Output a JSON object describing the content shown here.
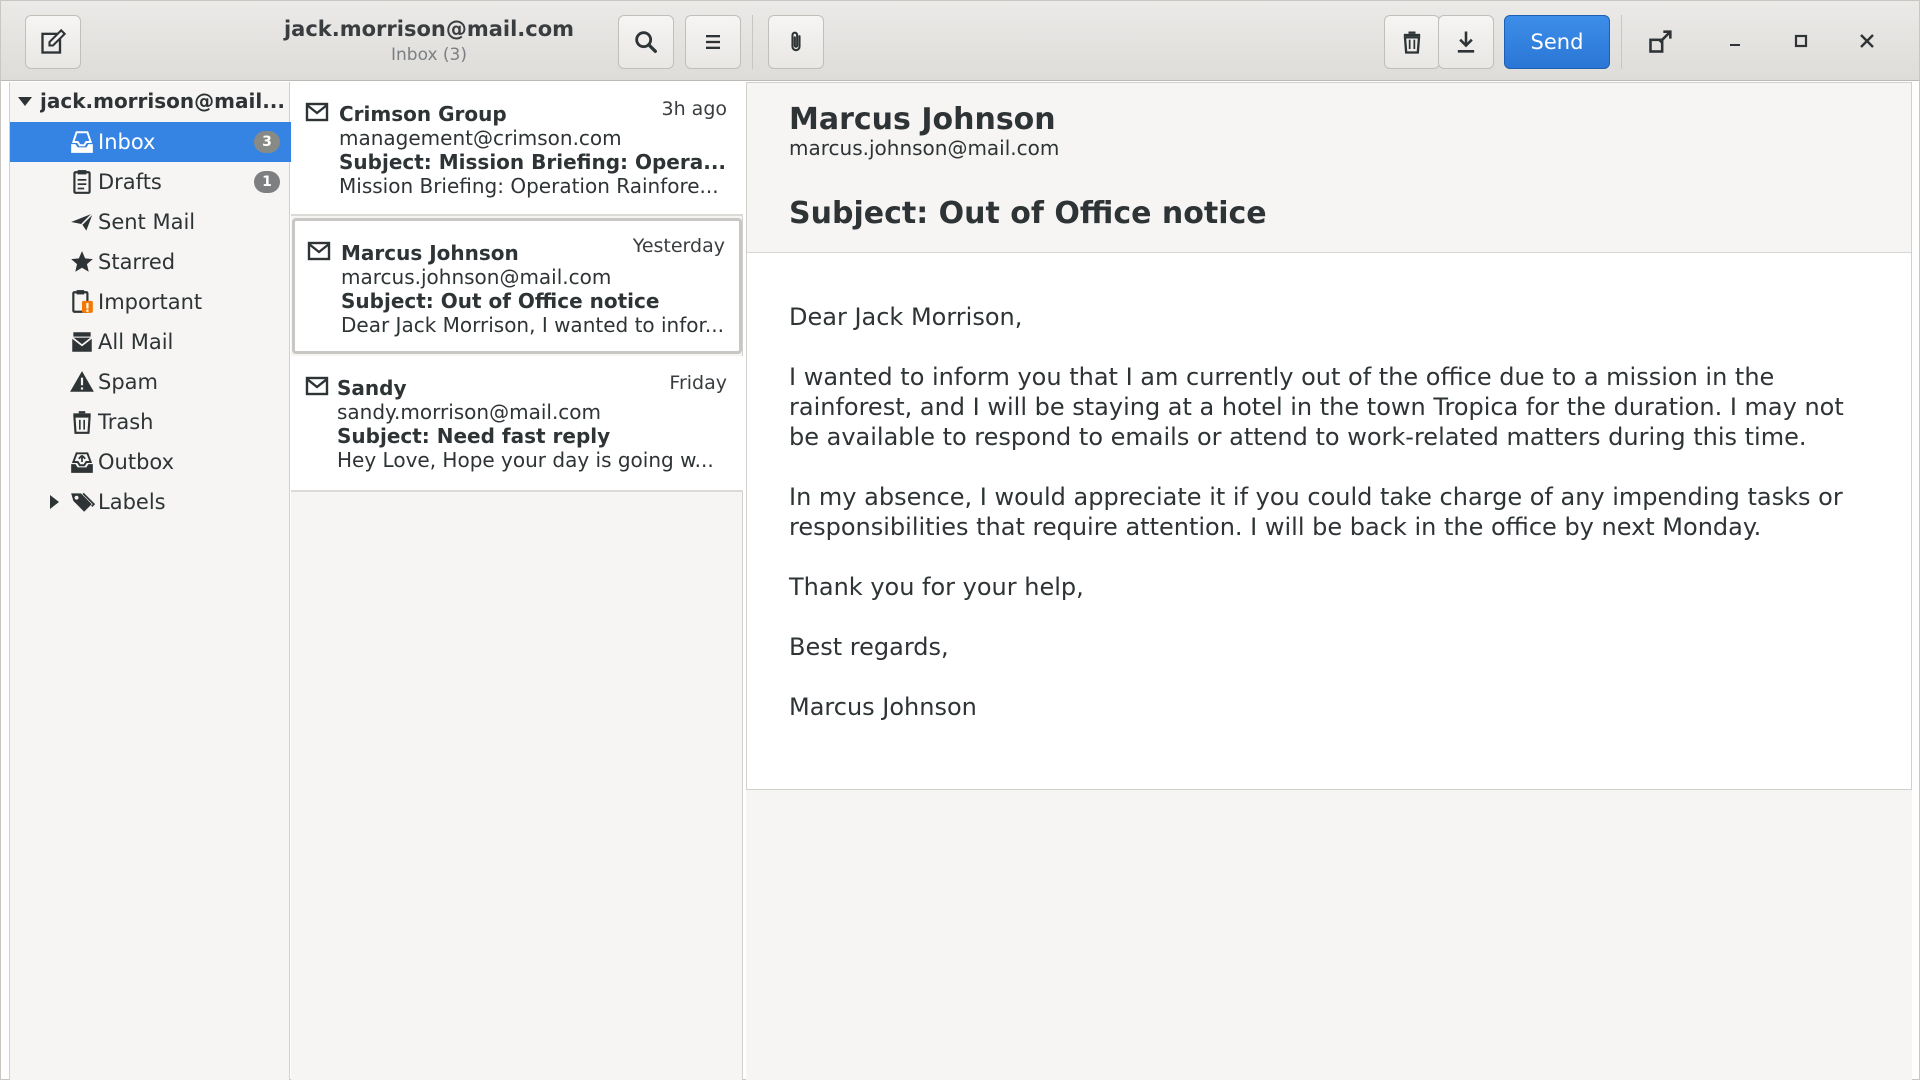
{
  "header": {
    "account_email": "jack.morrison@mail.com",
    "folder_status": "Inbox (3)",
    "send_label": "Send"
  },
  "sidebar": {
    "account_label": "jack.morrison@mail...",
    "folders": [
      {
        "label": "Inbox",
        "badge": "3",
        "icon": "inbox-icon"
      },
      {
        "label": "Drafts",
        "badge": "1",
        "icon": "drafts-icon"
      },
      {
        "label": "Sent Mail",
        "icon": "sent-icon"
      },
      {
        "label": "Starred",
        "icon": "star-icon"
      },
      {
        "label": "Important",
        "icon": "important-icon"
      },
      {
        "label": "All Mail",
        "icon": "all-mail-icon"
      },
      {
        "label": "Spam",
        "icon": "spam-icon"
      },
      {
        "label": "Trash",
        "icon": "trash-icon"
      },
      {
        "label": "Outbox",
        "icon": "outbox-icon"
      },
      {
        "label": "Labels",
        "icon": "label-icon"
      }
    ]
  },
  "messages": [
    {
      "sender": "Crimson Group",
      "time": "3h ago",
      "email": "management@crimson.com",
      "subject": "Subject: Mission Briefing: Opera...",
      "preview": "Mission Briefing: Operation Rainfore..."
    },
    {
      "sender": "Marcus Johnson",
      "time": "Yesterday",
      "email": "marcus.johnson@mail.com",
      "subject": "Subject: Out of Office notice",
      "preview": "Dear Jack Morrison, I wanted to infor..."
    },
    {
      "sender": "Sandy",
      "time": "Friday",
      "email": "sandy.morrison@mail.com",
      "subject": "Subject: Need fast reply",
      "preview": "Hey Love, Hope your day is going w..."
    }
  ],
  "reader": {
    "from_name": "Marcus Johnson",
    "from_email": "marcus.johnson@mail.com",
    "subject": "Subject: Out of Office notice",
    "body": [
      "Dear Jack Morrison,",
      "I wanted to inform you that I am currently out of the office due to a mission in the rainforest, and I will be staying at a hotel in the town Tropica for the duration. I may not be available to respond to emails or attend to work-related matters during this time.",
      "In my absence, I would appreciate it if you could take charge of any impending tasks or responsibilities that require attention. I will be back in the office by next Monday.",
      "Thank you for your help,",
      "Best regards,",
      "Marcus Johnson"
    ]
  },
  "colors": {
    "accent": "#3584e4",
    "send_button": "#2a76d6",
    "important_badge": "#f57900"
  }
}
